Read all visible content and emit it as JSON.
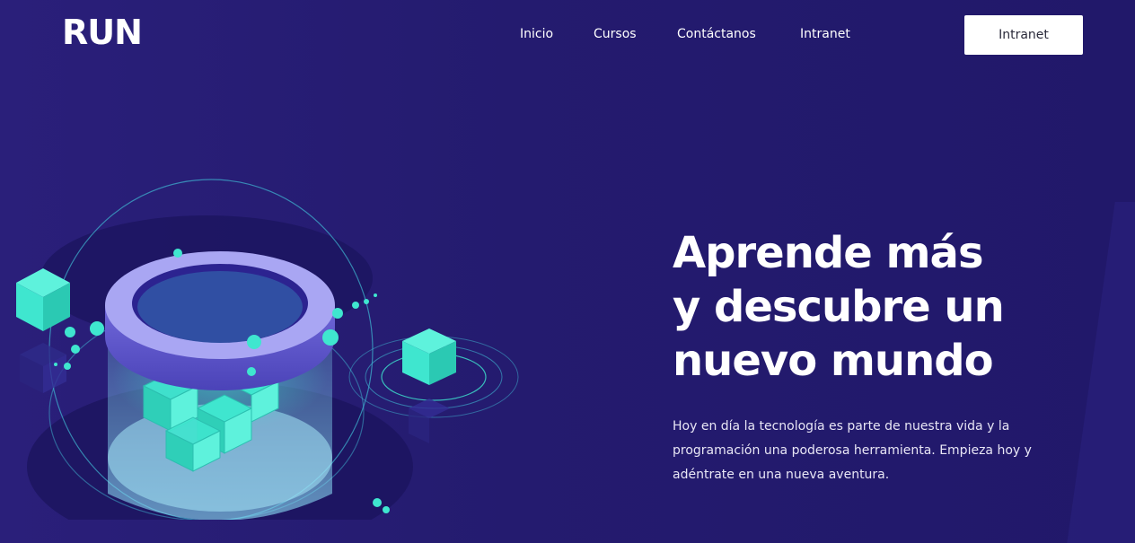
{
  "brand": {
    "logo": "RUN"
  },
  "nav": {
    "items": [
      {
        "label": "Inicio"
      },
      {
        "label": "Cursos"
      },
      {
        "label": "Contáctanos"
      },
      {
        "label": "Intranet"
      }
    ],
    "cta_label": "Intranet"
  },
  "hero": {
    "title_line1": "Aprende más",
    "title_line2": "y descubre un",
    "title_line3": "nuevo mundo",
    "description": "Hoy en día la tecnología es parte de nuestra vida y la programación una poderosa herramienta. Empieza hoy y adéntrate en una nueva aventura."
  },
  "colors": {
    "background": "#251c72",
    "accent_teal": "#3fe6cf",
    "ring_lavender": "#8a86e8",
    "button_bg": "#ffffff"
  },
  "illustration": {
    "icon": "cube-cylinder-illustration"
  }
}
